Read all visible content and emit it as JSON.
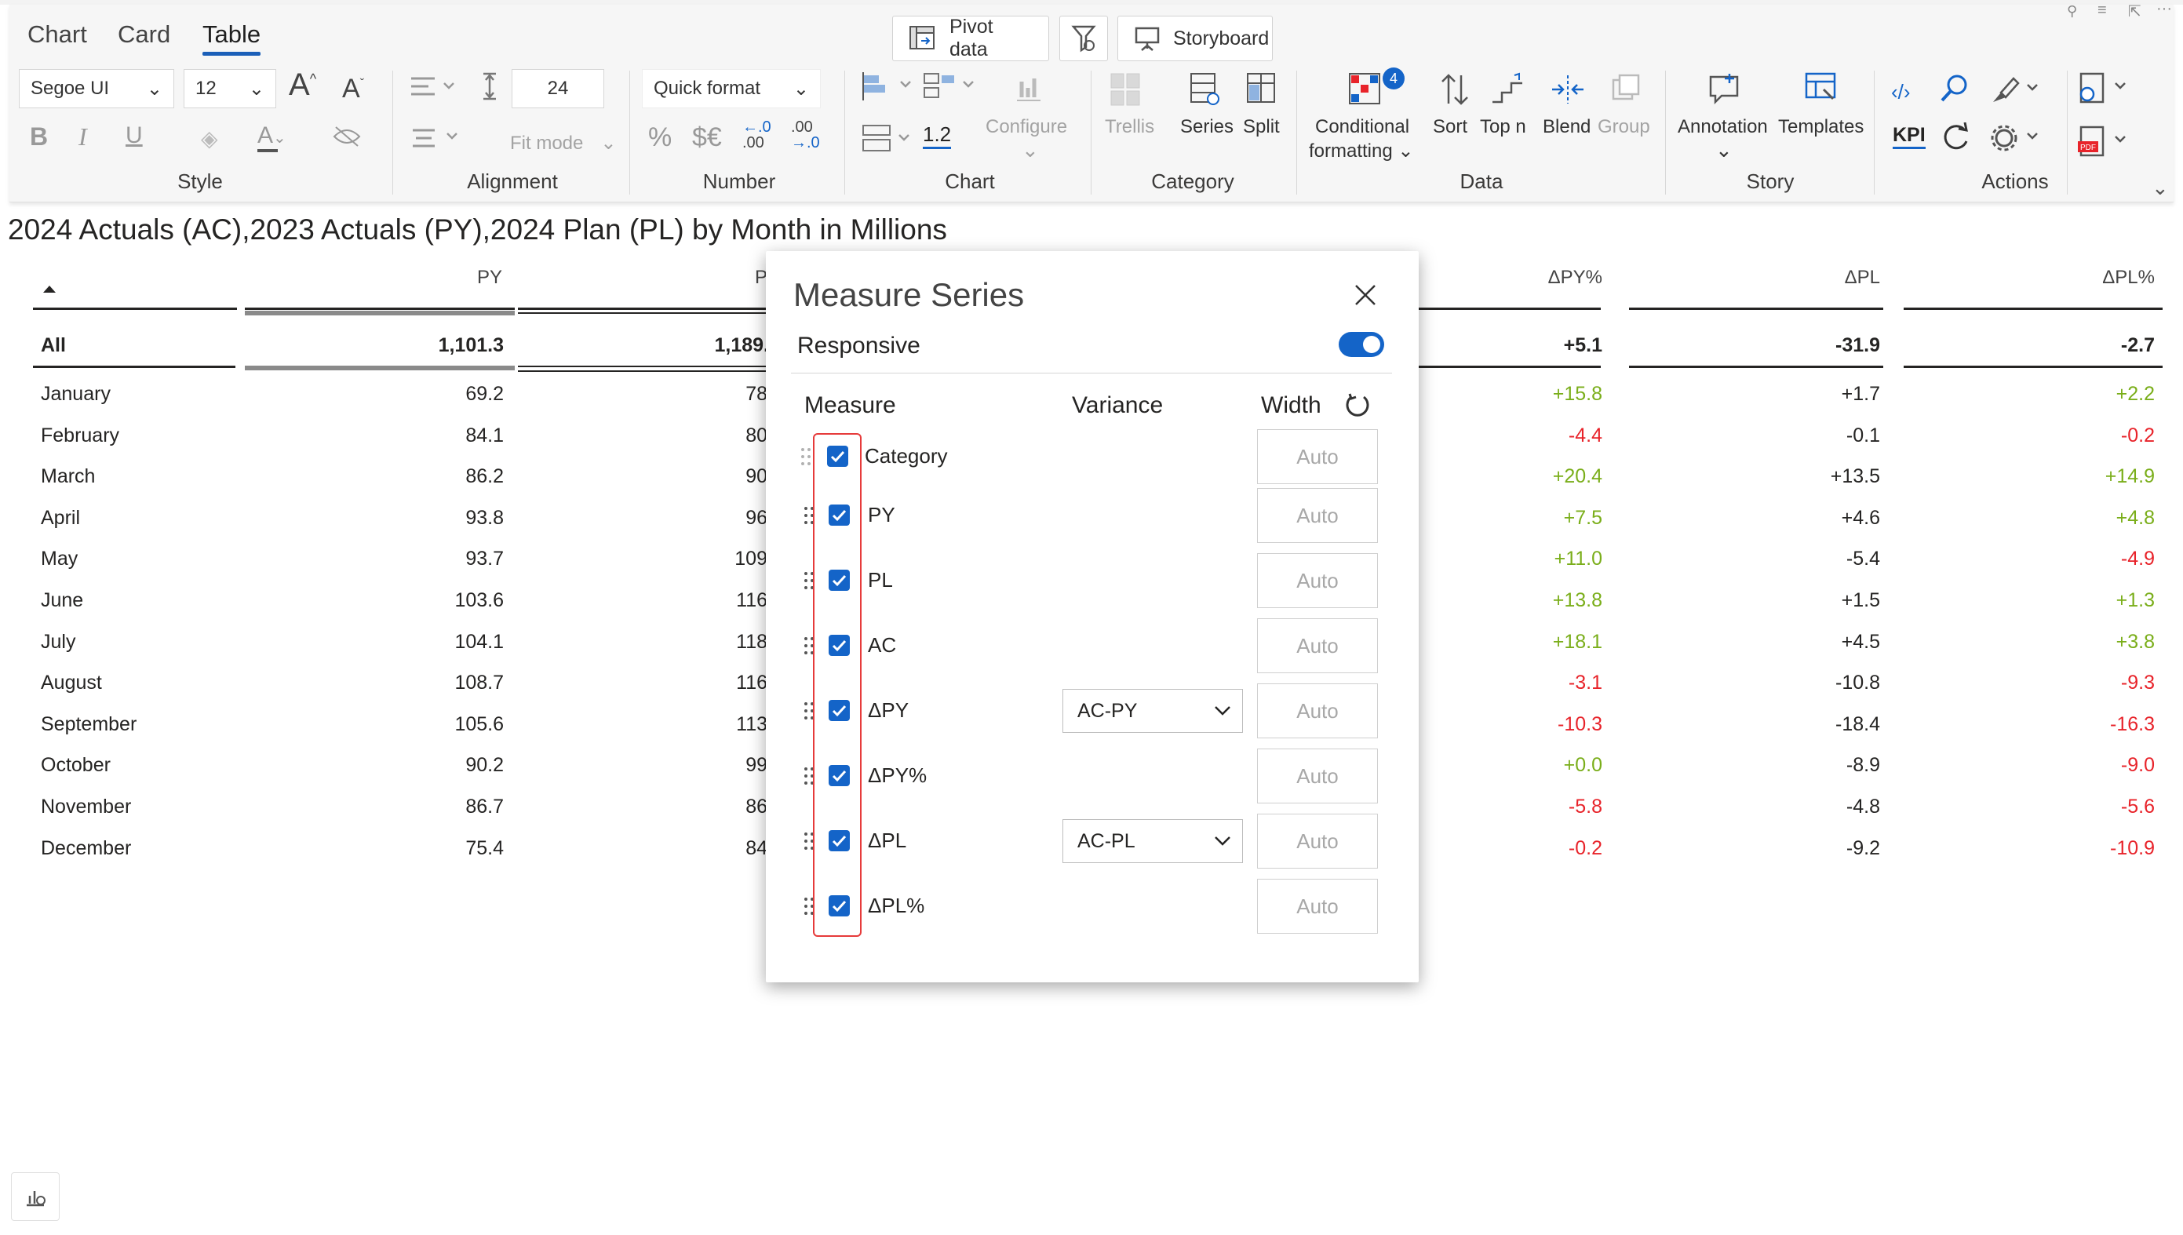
{
  "tabs": [
    "Chart",
    "Card",
    "Table"
  ],
  "top_buttons": {
    "pivot": "Pivot  data",
    "storyboard": "Storyboard"
  },
  "style": {
    "font": "Segoe UI",
    "size": "12",
    "group": "Style"
  },
  "alignment": {
    "value": "24",
    "fit_mode": "Fit mode",
    "group": "Alignment"
  },
  "number": {
    "quick_format": "Quick format",
    "percent": "%",
    "currency": "$€",
    "dec_down": ".00",
    "dec_up": ".00",
    "group": "Number"
  },
  "chart": {
    "scale": "1.2",
    "configure": "Configure",
    "group": "Chart"
  },
  "category": {
    "trellis": "Trellis",
    "series": "Series",
    "split": "Split",
    "group": "Category"
  },
  "data": {
    "cond_format": "Conditional",
    "cond_format2": "formatting",
    "badge": "4",
    "sort": "Sort",
    "topn": "Top n",
    "blend": "Blend",
    "group_btn": "Group",
    "group": "Data"
  },
  "story": {
    "annotation": "Annotation",
    "templates": "Templates",
    "group": "Story"
  },
  "actions": {
    "kpi": "KPI",
    "group": "Actions"
  },
  "table": {
    "title": "2024 Actuals (AC),2023 Actuals (PY),2024 Plan (PL) by Month in Millions",
    "headers": {
      "py": "PY",
      "pl": "P",
      "dpyp": "ΔPY%",
      "dpl": "ΔPL",
      "dplp": "ΔPL%"
    },
    "all": {
      "label": "All",
      "py": "1,101.3",
      "pl": "1,189.",
      "dpyp": "+5.1",
      "dpl": "-31.9",
      "dplp": "-2.7"
    },
    "rows": [
      {
        "m": "January",
        "py": "69.2",
        "pl": "78",
        "dpyp": "+15.8",
        "dpl": "+1.7",
        "dplp": "+2.2"
      },
      {
        "m": "February",
        "py": "84.1",
        "pl": "80",
        "dpyp": "-4.4",
        "dpl": "-0.1",
        "dplp": "-0.2"
      },
      {
        "m": "March",
        "py": "86.2",
        "pl": "90",
        "dpyp": "+20.4",
        "dpl": "+13.5",
        "dplp": "+14.9"
      },
      {
        "m": "April",
        "py": "93.8",
        "pl": "96",
        "dpyp": "+7.5",
        "dpl": "+4.6",
        "dplp": "+4.8"
      },
      {
        "m": "May",
        "py": "93.7",
        "pl": "109",
        "dpyp": "+11.0",
        "dpl": "-5.4",
        "dplp": "-4.9"
      },
      {
        "m": "June",
        "py": "103.6",
        "pl": "116",
        "dpyp": "+13.8",
        "dpl": "+1.5",
        "dplp": "+1.3"
      },
      {
        "m": "July",
        "py": "104.1",
        "pl": "118",
        "dpyp": "+18.1",
        "dpl": "+4.5",
        "dplp": "+3.8"
      },
      {
        "m": "August",
        "py": "108.7",
        "pl": "116",
        "dpyp": "-3.1",
        "dpl": "-10.8",
        "dplp": "-9.3"
      },
      {
        "m": "September",
        "py": "105.6",
        "pl": "113",
        "dpyp": "-10.3",
        "dpl": "-18.4",
        "dplp": "-16.3"
      },
      {
        "m": "October",
        "py": "90.2",
        "pl": "99",
        "dpyp": "+0.0",
        "dpl": "-8.9",
        "dplp": "-9.0"
      },
      {
        "m": "November",
        "py": "86.7",
        "pl": "86",
        "dpyp": "-5.8",
        "dpl": "-4.8",
        "dplp": "-5.6"
      },
      {
        "m": "December",
        "py": "75.4",
        "pl": "84",
        "dpyp": "-0.2",
        "dpl": "-9.2",
        "dplp": "-10.9"
      }
    ]
  },
  "dialog": {
    "title": "Measure Series",
    "responsive": "Responsive",
    "col_measure": "Measure",
    "col_variance": "Variance",
    "col_width": "Width",
    "auto": "Auto",
    "measures": [
      {
        "label": "Category",
        "variance": ""
      },
      {
        "label": "PY",
        "variance": ""
      },
      {
        "label": "PL",
        "variance": ""
      },
      {
        "label": "AC",
        "variance": ""
      },
      {
        "label": "ΔPY",
        "variance": "AC-PY"
      },
      {
        "label": "ΔPY%",
        "variance": ""
      },
      {
        "label": "ΔPL",
        "variance": "AC-PL"
      },
      {
        "label": "ΔPL%",
        "variance": ""
      }
    ]
  },
  "colors": {
    "accent": "#1464c8",
    "positive": "#7aae1a",
    "negative": "#e8232a",
    "highlight": "#e63b3b"
  }
}
